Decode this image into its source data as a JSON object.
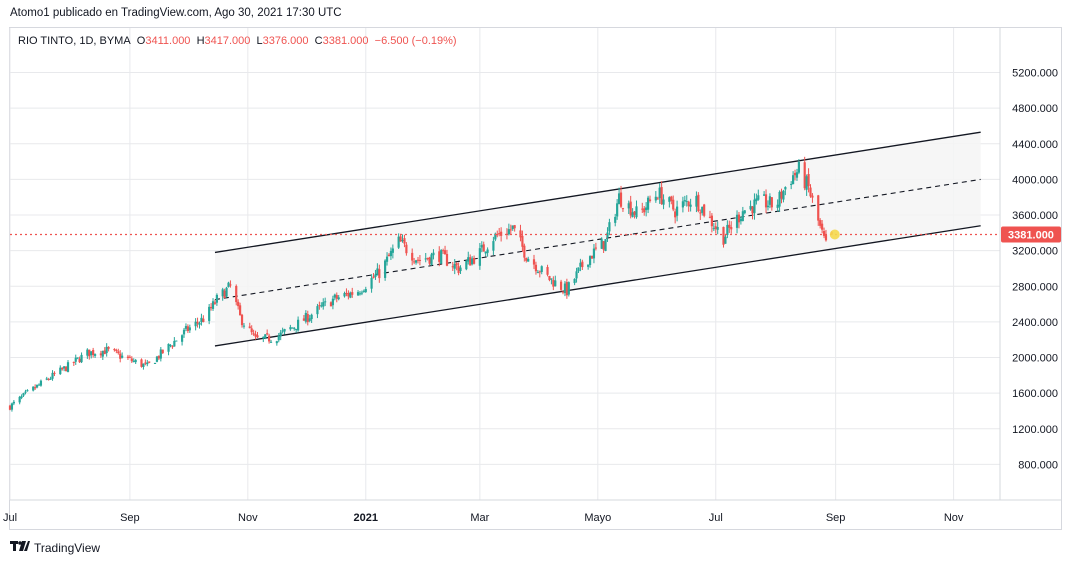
{
  "header": {
    "published_line": "Atomo1 publicado en TradingView.com, Ago 30, 2021 17:30 UTC"
  },
  "legend": {
    "symbol": "RIO TINTO, 1D, BYMA",
    "o_label": "O",
    "o_value": "3411.000",
    "h_label": "H",
    "h_value": "3417.000",
    "l_label": "L",
    "l_value": "3376.000",
    "c_label": "C",
    "c_value": "3381.000",
    "change": "−6.500 (−0.19%)"
  },
  "footer": {
    "brand": "TradingView"
  },
  "colors": {
    "up": "#26a69a",
    "down": "#ef5350",
    "grid": "#e8e9ec",
    "channel_fill": "#f4f4f4",
    "price_line": "#ef5350"
  },
  "icons": {
    "brand_logo": "tradingview-logo-icon"
  },
  "chart_data": {
    "type": "candlestick",
    "symbol": "RIO TINTO",
    "interval": "1D",
    "exchange": "BYMA",
    "x_ticks": [
      {
        "label": "Jul",
        "date": "2020-07-01"
      },
      {
        "label": "Sep",
        "date": "2020-09-01"
      },
      {
        "label": "Nov",
        "date": "2020-11-01"
      },
      {
        "label": "2021",
        "date": "2021-01-01"
      },
      {
        "label": "Mar",
        "date": "2021-03-01"
      },
      {
        "label": "Mayo",
        "date": "2021-05-01"
      },
      {
        "label": "Jul",
        "date": "2021-07-01"
      },
      {
        "label": "Sep",
        "date": "2021-09-01"
      },
      {
        "label": "Nov",
        "date": "2021-11-01"
      }
    ],
    "y_ticks": [
      "800.000",
      "1200.000",
      "1600.000",
      "2000.000",
      "2400.000",
      "2800.000",
      "3200.000",
      "3600.000",
      "4000.000",
      "4400.000",
      "4800.000",
      "5200.000"
    ],
    "ylim": [
      400,
      5700
    ],
    "xlim": [
      "2020-07-01",
      "2021-11-25"
    ],
    "last_price": 3381,
    "last_price_label": "3381.000",
    "grid": true,
    "price_path": [
      [
        "2020-07-01",
        1450
      ],
      [
        "2020-07-10",
        1600
      ],
      [
        "2020-07-20",
        1750
      ],
      [
        "2020-07-31",
        1900
      ],
      [
        "2020-08-10",
        2050
      ],
      [
        "2020-08-20",
        2080
      ],
      [
        "2020-08-31",
        1980
      ],
      [
        "2020-09-10",
        1900
      ],
      [
        "2020-09-20",
        2100
      ],
      [
        "2020-09-30",
        2300
      ],
      [
        "2020-10-10",
        2450
      ],
      [
        "2020-10-16",
        2650
      ],
      [
        "2020-10-23",
        2800
      ],
      [
        "2020-10-28",
        2450
      ],
      [
        "2020-11-05",
        2200
      ],
      [
        "2020-11-15",
        2220
      ],
      [
        "2020-11-25",
        2350
      ],
      [
        "2020-12-05",
        2500
      ],
      [
        "2020-12-15",
        2650
      ],
      [
        "2020-12-28",
        2750
      ],
      [
        "2021-01-08",
        2950
      ],
      [
        "2021-01-18",
        3300
      ],
      [
        "2021-01-28",
        3100
      ],
      [
        "2021-02-08",
        3150
      ],
      [
        "2021-02-18",
        3000
      ],
      [
        "2021-02-28",
        3150
      ],
      [
        "2021-03-08",
        3350
      ],
      [
        "2021-03-18",
        3450
      ],
      [
        "2021-03-25",
        3150
      ],
      [
        "2021-04-05",
        2900
      ],
      [
        "2021-04-15",
        2750
      ],
      [
        "2021-04-25",
        3100
      ],
      [
        "2021-05-05",
        3300
      ],
      [
        "2021-05-12",
        3800
      ],
      [
        "2021-05-22",
        3600
      ],
      [
        "2021-06-01",
        3850
      ],
      [
        "2021-06-10",
        3650
      ],
      [
        "2021-06-20",
        3800
      ],
      [
        "2021-06-28",
        3550
      ],
      [
        "2021-07-05",
        3350
      ],
      [
        "2021-07-15",
        3650
      ],
      [
        "2021-07-25",
        3750
      ],
      [
        "2021-08-01",
        3700
      ],
      [
        "2021-08-08",
        4000
      ],
      [
        "2021-08-13",
        4100
      ],
      [
        "2021-08-18",
        3900
      ],
      [
        "2021-08-24",
        3450
      ],
      [
        "2021-08-27",
        3250
      ],
      [
        "2021-08-30",
        3381
      ]
    ],
    "channel": {
      "start": "2020-10-15",
      "end": "2021-11-15",
      "upper": [
        3180,
        4530
      ],
      "middle": [
        2650,
        4000
      ],
      "lower": [
        2130,
        3480
      ]
    }
  }
}
